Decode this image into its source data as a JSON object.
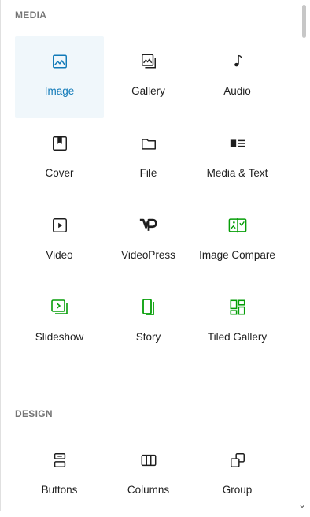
{
  "sections": [
    {
      "title": "MEDIA",
      "blocks": [
        {
          "label": "Image",
          "icon": "image-icon",
          "selected": true
        },
        {
          "label": "Gallery",
          "icon": "gallery-icon"
        },
        {
          "label": "Audio",
          "icon": "audio-icon"
        },
        {
          "label": "Cover",
          "icon": "cover-icon"
        },
        {
          "label": "File",
          "icon": "file-icon"
        },
        {
          "label": "Media & Text",
          "icon": "media-text-icon"
        },
        {
          "label": "Video",
          "icon": "video-icon"
        },
        {
          "label": "VideoPress",
          "icon": "videopress-icon"
        },
        {
          "label": "Image Compare",
          "icon": "image-compare-icon"
        },
        {
          "label": "Slideshow",
          "icon": "slideshow-icon"
        },
        {
          "label": "Story",
          "icon": "story-icon"
        },
        {
          "label": "Tiled Gallery",
          "icon": "tiled-gallery-icon"
        }
      ]
    },
    {
      "title": "DESIGN",
      "blocks": [
        {
          "label": "Buttons",
          "icon": "buttons-icon"
        },
        {
          "label": "Columns",
          "icon": "columns-icon"
        },
        {
          "label": "Group",
          "icon": "group-icon"
        }
      ]
    }
  ],
  "colors": {
    "selected_bg": "#f0f7fb",
    "selected_text": "#117ab8",
    "jetpack_green": "#069e08",
    "icon": "#1e1e1e"
  }
}
